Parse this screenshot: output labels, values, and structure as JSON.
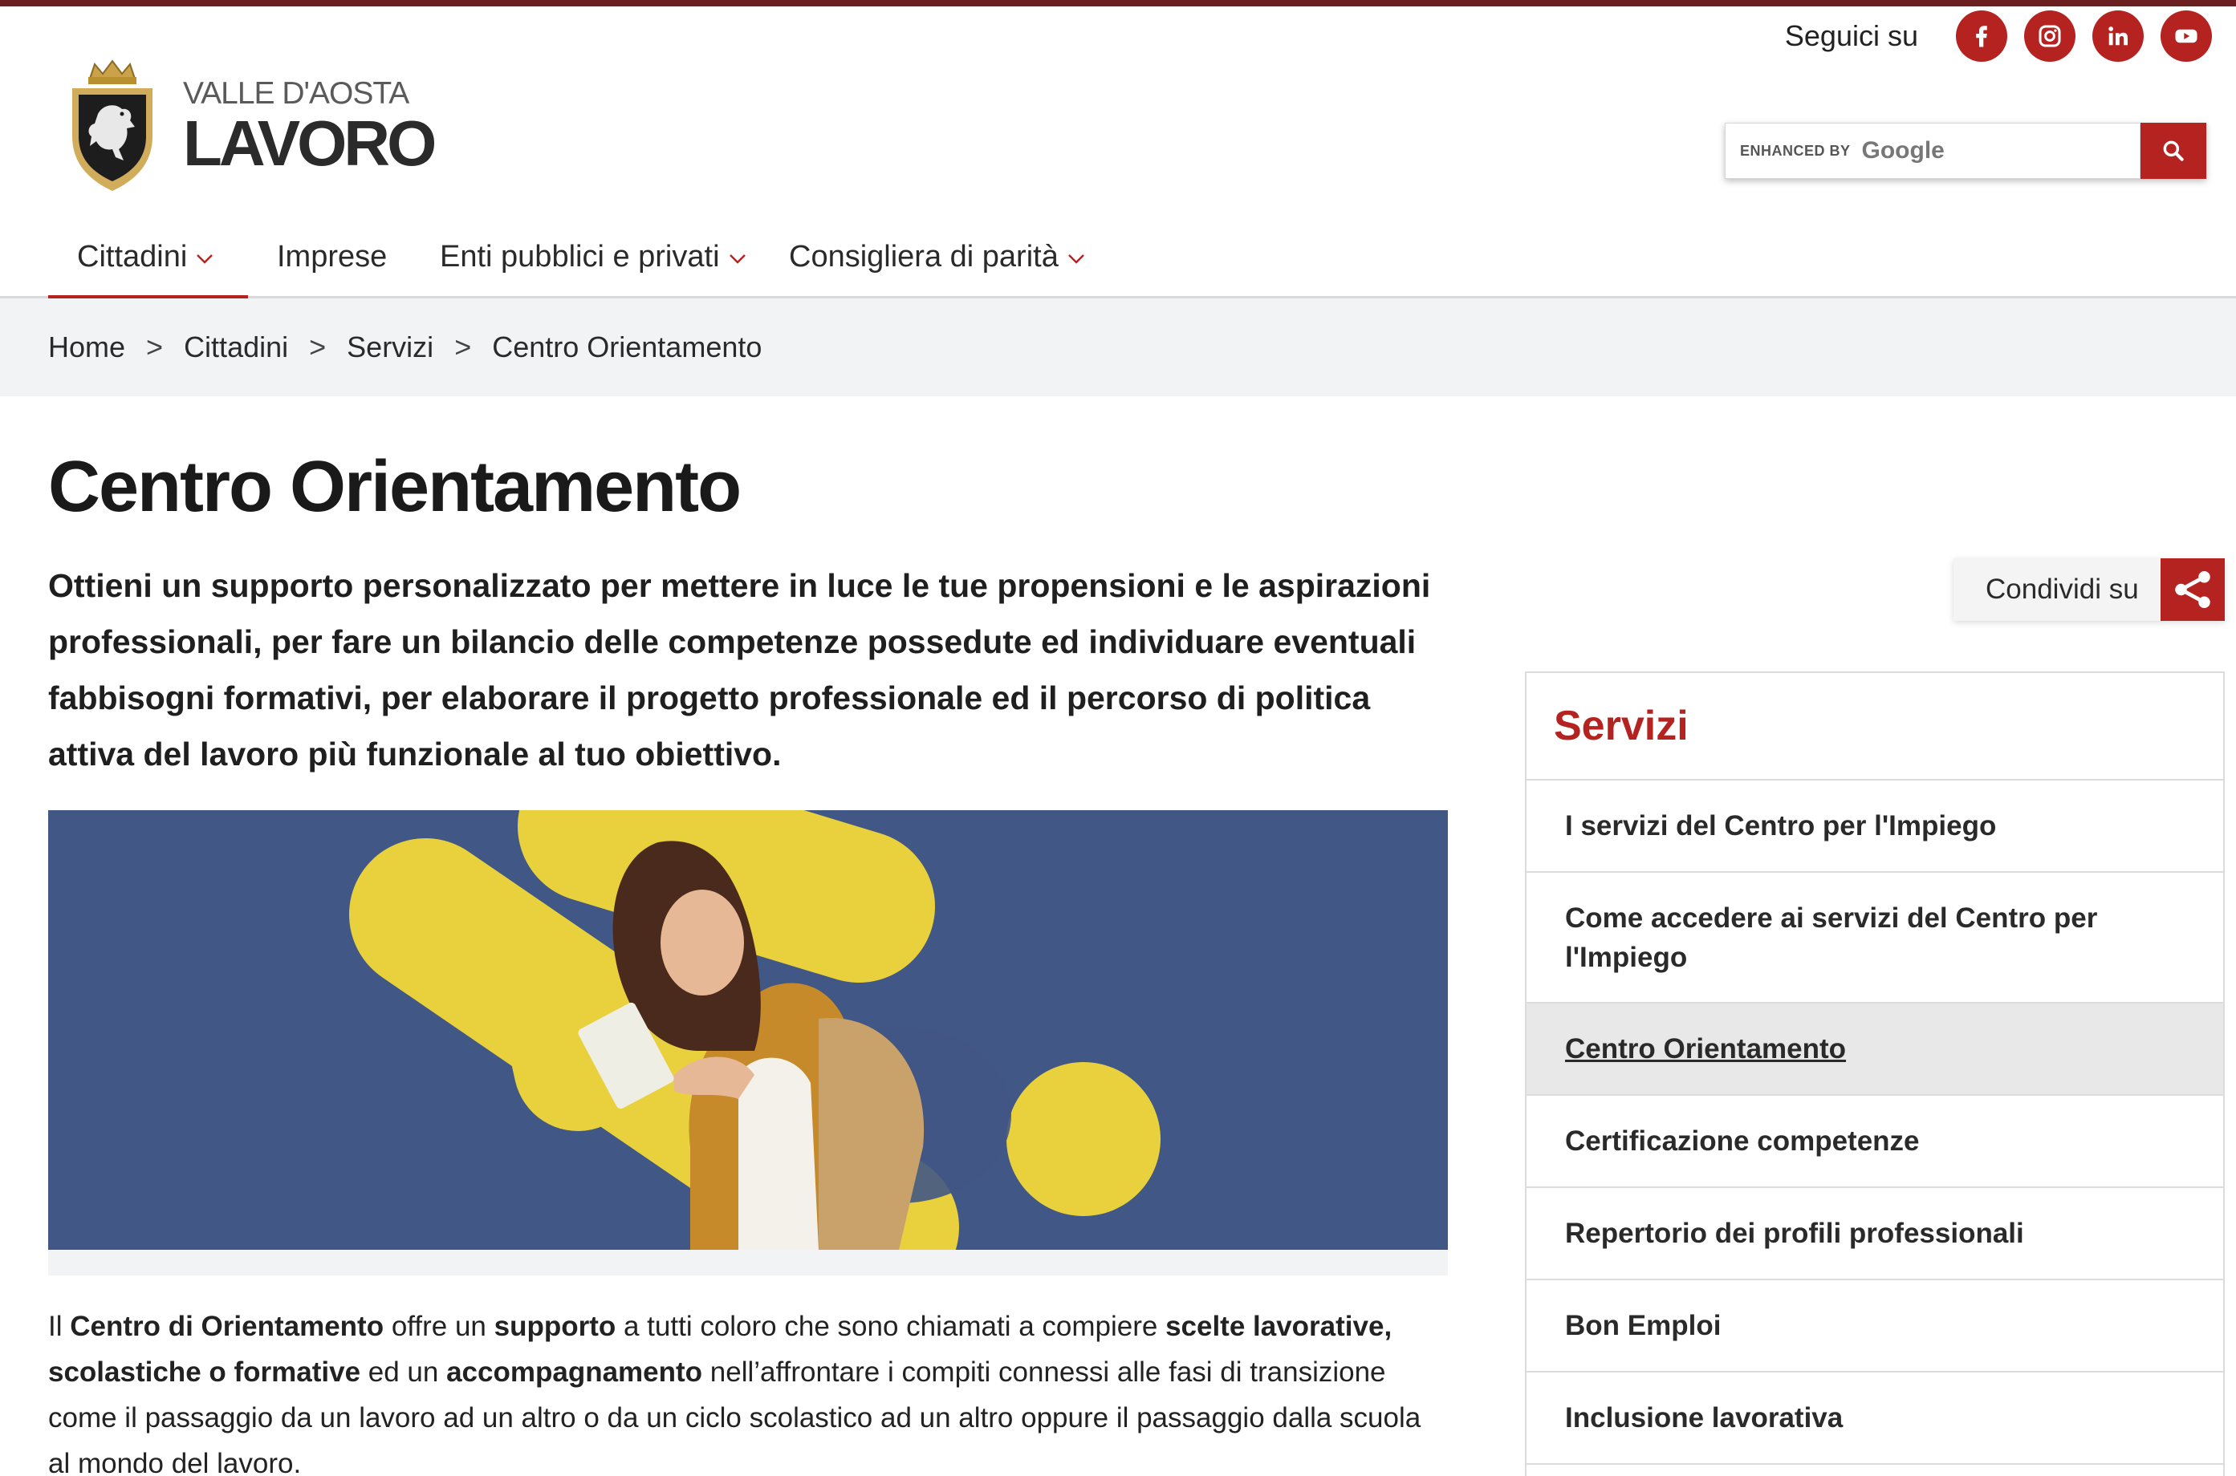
{
  "social": {
    "label": "Seguici su",
    "links": [
      {
        "icon": "facebook-icon"
      },
      {
        "icon": "instagram-icon"
      },
      {
        "icon": "linkedin-icon"
      },
      {
        "icon": "youtube-icon"
      }
    ]
  },
  "brand": {
    "region": "VALLE D'AOSTA",
    "name": "LAVORO"
  },
  "search": {
    "enhanced_label": "ENHANCED BY",
    "google_label": "Google",
    "button_icon": "search-icon"
  },
  "nav": {
    "items": [
      {
        "label": "Cittadini",
        "active": true,
        "dropdown": true
      },
      {
        "label": "Imprese",
        "active": false,
        "dropdown": false
      },
      {
        "label": "Enti pubblici e privati",
        "active": false,
        "dropdown": true
      },
      {
        "label": "Consigliera di parità",
        "active": false,
        "dropdown": true
      }
    ]
  },
  "breadcrumb": {
    "items": [
      "Home",
      "Cittadini",
      "Servizi",
      "Centro Orientamento"
    ],
    "separator": ">"
  },
  "page": {
    "title": "Centro Orientamento",
    "lead": "Ottieni un supporto personalizzato per mettere in luce le tue propensioni e le aspirazioni professionali, per fare un bilancio delle competenze possedute ed individuare eventuali fabbisogni formativi, per elaborare il progetto professionale ed il percorso di politica attiva del lavoro più funzionale al tuo obiettivo.",
    "body": {
      "p1": "Il ",
      "b1": "Centro di Orientamento",
      "p2": " offre un ",
      "b2": "supporto",
      "p3": " a tutti coloro che sono chiamati a compiere ",
      "b3": "scelte lavorative, scolastiche o formative",
      "p4": " ed un ",
      "b4": "accompagnamento",
      "p5": " nell’affrontare i compiti connessi alle fasi di transizione come il passaggio da un lavoro ad un altro o da un ciclo scolastico ad un altro oppure il passaggio dalla scuola al mondo del lavoro."
    }
  },
  "share": {
    "label": "Condividi su",
    "icon": "share-icon"
  },
  "sidebar": {
    "title": "Servizi",
    "items": [
      {
        "label": "I servizi del Centro per l'Impiego",
        "current": false
      },
      {
        "label": "Come accedere ai servizi del Centro per l'Impiego",
        "current": false
      },
      {
        "label": "Centro Orientamento",
        "current": true
      },
      {
        "label": "Certificazione competenze",
        "current": false
      },
      {
        "label": "Repertorio dei profili professionali",
        "current": false
      },
      {
        "label": "Bon Emploi",
        "current": false
      },
      {
        "label": "Inclusione lavorativa",
        "current": false
      }
    ]
  },
  "colors": {
    "brand_red": "#b52321",
    "top_bar": "#6b1f21",
    "hero_blue": "#415785",
    "hero_yellow": "#e8d13c",
    "breadcrumb_bg": "#f2f3f5"
  }
}
